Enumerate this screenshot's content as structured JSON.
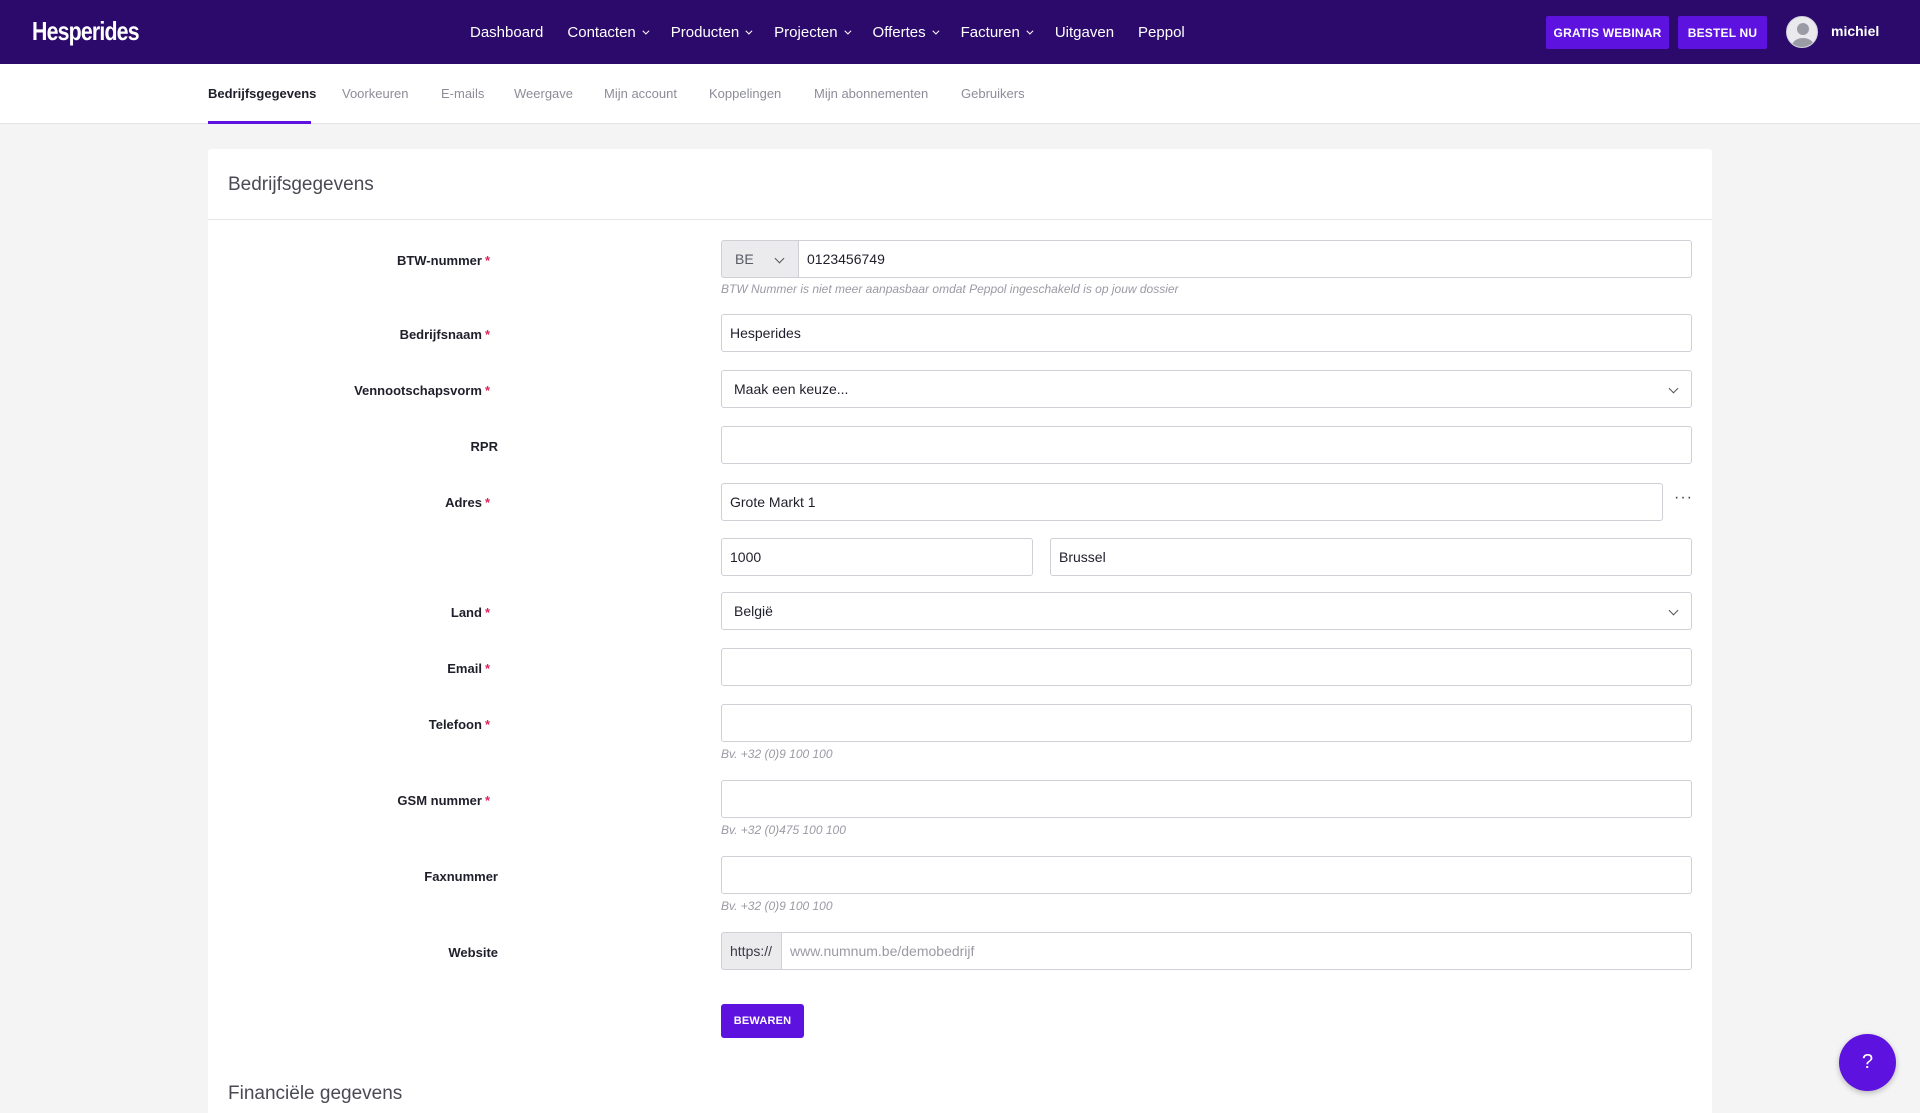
{
  "header": {
    "logo": "Hesperides",
    "nav": [
      {
        "label": "Dashboard",
        "dropdown": false
      },
      {
        "label": "Contacten",
        "dropdown": true
      },
      {
        "label": "Producten",
        "dropdown": true
      },
      {
        "label": "Projecten",
        "dropdown": true
      },
      {
        "label": "Offertes",
        "dropdown": true
      },
      {
        "label": "Facturen",
        "dropdown": true
      },
      {
        "label": "Uitgaven",
        "dropdown": false
      },
      {
        "label": "Peppol",
        "dropdown": false
      }
    ],
    "webinar_button": "GRATIS WEBINAR",
    "order_button": "BESTEL NU",
    "username": "michiel"
  },
  "tabs": [
    {
      "label": "Bedrijfsgegevens",
      "active": true
    },
    {
      "label": "Voorkeuren",
      "active": false
    },
    {
      "label": "E-mails",
      "active": false
    },
    {
      "label": "Weergave",
      "active": false
    },
    {
      "label": "Mijn account",
      "active": false
    },
    {
      "label": "Koppelingen",
      "active": false
    },
    {
      "label": "Mijn abonnementen",
      "active": false
    },
    {
      "label": "Gebruikers",
      "active": false
    }
  ],
  "form": {
    "title": "Bedrijfsgegevens",
    "required_marker": "*",
    "btw": {
      "label": "BTW-nummer",
      "country": "BE",
      "value": "0123456749",
      "hint": "BTW Nummer is niet meer aanpasbaar omdat Peppol ingeschakeld is op jouw dossier"
    },
    "bedrijfsnaam": {
      "label": "Bedrijfsnaam",
      "value": "Hesperides"
    },
    "vennootschapsvorm": {
      "label": "Vennootschapsvorm",
      "value": "Maak een keuze..."
    },
    "rpr": {
      "label": "RPR",
      "value": ""
    },
    "adres": {
      "label": "Adres",
      "street": "Grote Markt 1",
      "postcode": "1000",
      "city": "Brussel",
      "more": "···"
    },
    "land": {
      "label": "Land",
      "value": "België"
    },
    "email": {
      "label": "Email",
      "value": ""
    },
    "telefoon": {
      "label": "Telefoon",
      "value": "",
      "hint": "Bv. +32 (0)9 100 100"
    },
    "gsm": {
      "label": "GSM nummer",
      "value": "",
      "hint": "Bv. +32 (0)475 100 100"
    },
    "fax": {
      "label": "Faxnummer",
      "value": "",
      "hint": "Bv. +32 (0)9 100 100"
    },
    "website": {
      "label": "Website",
      "prefix": "https://",
      "placeholder": "www.numnum.be/demobedrijf"
    },
    "save_label": "BEWAREN"
  },
  "section2": {
    "title": "Financiële gegevens"
  },
  "help": {
    "label": "?"
  },
  "colors": {
    "header_bg": "#2b0a6b",
    "accent": "#5d12e0",
    "required": "#e0245e"
  }
}
